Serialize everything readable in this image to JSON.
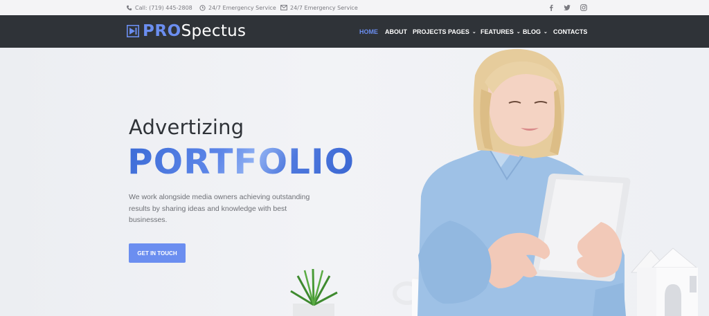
{
  "topbar": {
    "phone": "Call: (719) 445-2808",
    "emergency1": "24/7 Emergency Service",
    "emergency2": "24/7 Emergency Service",
    "social_icons": [
      "facebook-icon",
      "twitter-icon",
      "instagram-icon"
    ]
  },
  "logo": {
    "pro": "PRO",
    "rest": "Spectus"
  },
  "nav": {
    "home": "HOME",
    "about": "ABOUT",
    "projects": "PROJECTS",
    "pages": "PAGES",
    "features": "FEATURES",
    "blog": "BLOG",
    "contacts": "CONTACTS"
  },
  "hero": {
    "subtitle": "Advertizing",
    "title": "PORTFOLIO",
    "description": "We work alongside media owners achieving outstanding results by sharing ideas and knowledge with best businesses.",
    "cta": "GET IN TOUCH"
  },
  "colors": {
    "accent": "#6b8ef0",
    "navbar": "#2f3338",
    "topbar": "#f4f4f6"
  }
}
